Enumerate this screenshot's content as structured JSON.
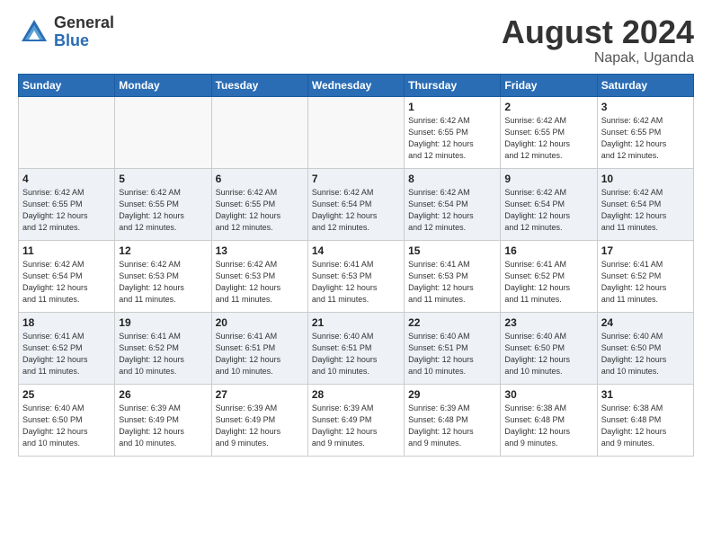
{
  "header": {
    "logo_general": "General",
    "logo_blue": "Blue",
    "month_year": "August 2024",
    "location": "Napak, Uganda"
  },
  "days_of_week": [
    "Sunday",
    "Monday",
    "Tuesday",
    "Wednesday",
    "Thursday",
    "Friday",
    "Saturday"
  ],
  "weeks": [
    [
      {
        "day": "",
        "info": ""
      },
      {
        "day": "",
        "info": ""
      },
      {
        "day": "",
        "info": ""
      },
      {
        "day": "",
        "info": ""
      },
      {
        "day": "1",
        "info": "Sunrise: 6:42 AM\nSunset: 6:55 PM\nDaylight: 12 hours\nand 12 minutes."
      },
      {
        "day": "2",
        "info": "Sunrise: 6:42 AM\nSunset: 6:55 PM\nDaylight: 12 hours\nand 12 minutes."
      },
      {
        "day": "3",
        "info": "Sunrise: 6:42 AM\nSunset: 6:55 PM\nDaylight: 12 hours\nand 12 minutes."
      }
    ],
    [
      {
        "day": "4",
        "info": "Sunrise: 6:42 AM\nSunset: 6:55 PM\nDaylight: 12 hours\nand 12 minutes."
      },
      {
        "day": "5",
        "info": "Sunrise: 6:42 AM\nSunset: 6:55 PM\nDaylight: 12 hours\nand 12 minutes."
      },
      {
        "day": "6",
        "info": "Sunrise: 6:42 AM\nSunset: 6:55 PM\nDaylight: 12 hours\nand 12 minutes."
      },
      {
        "day": "7",
        "info": "Sunrise: 6:42 AM\nSunset: 6:54 PM\nDaylight: 12 hours\nand 12 minutes."
      },
      {
        "day": "8",
        "info": "Sunrise: 6:42 AM\nSunset: 6:54 PM\nDaylight: 12 hours\nand 12 minutes."
      },
      {
        "day": "9",
        "info": "Sunrise: 6:42 AM\nSunset: 6:54 PM\nDaylight: 12 hours\nand 12 minutes."
      },
      {
        "day": "10",
        "info": "Sunrise: 6:42 AM\nSunset: 6:54 PM\nDaylight: 12 hours\nand 11 minutes."
      }
    ],
    [
      {
        "day": "11",
        "info": "Sunrise: 6:42 AM\nSunset: 6:54 PM\nDaylight: 12 hours\nand 11 minutes."
      },
      {
        "day": "12",
        "info": "Sunrise: 6:42 AM\nSunset: 6:53 PM\nDaylight: 12 hours\nand 11 minutes."
      },
      {
        "day": "13",
        "info": "Sunrise: 6:42 AM\nSunset: 6:53 PM\nDaylight: 12 hours\nand 11 minutes."
      },
      {
        "day": "14",
        "info": "Sunrise: 6:41 AM\nSunset: 6:53 PM\nDaylight: 12 hours\nand 11 minutes."
      },
      {
        "day": "15",
        "info": "Sunrise: 6:41 AM\nSunset: 6:53 PM\nDaylight: 12 hours\nand 11 minutes."
      },
      {
        "day": "16",
        "info": "Sunrise: 6:41 AM\nSunset: 6:52 PM\nDaylight: 12 hours\nand 11 minutes."
      },
      {
        "day": "17",
        "info": "Sunrise: 6:41 AM\nSunset: 6:52 PM\nDaylight: 12 hours\nand 11 minutes."
      }
    ],
    [
      {
        "day": "18",
        "info": "Sunrise: 6:41 AM\nSunset: 6:52 PM\nDaylight: 12 hours\nand 11 minutes."
      },
      {
        "day": "19",
        "info": "Sunrise: 6:41 AM\nSunset: 6:52 PM\nDaylight: 12 hours\nand 10 minutes."
      },
      {
        "day": "20",
        "info": "Sunrise: 6:41 AM\nSunset: 6:51 PM\nDaylight: 12 hours\nand 10 minutes."
      },
      {
        "day": "21",
        "info": "Sunrise: 6:40 AM\nSunset: 6:51 PM\nDaylight: 12 hours\nand 10 minutes."
      },
      {
        "day": "22",
        "info": "Sunrise: 6:40 AM\nSunset: 6:51 PM\nDaylight: 12 hours\nand 10 minutes."
      },
      {
        "day": "23",
        "info": "Sunrise: 6:40 AM\nSunset: 6:50 PM\nDaylight: 12 hours\nand 10 minutes."
      },
      {
        "day": "24",
        "info": "Sunrise: 6:40 AM\nSunset: 6:50 PM\nDaylight: 12 hours\nand 10 minutes."
      }
    ],
    [
      {
        "day": "25",
        "info": "Sunrise: 6:40 AM\nSunset: 6:50 PM\nDaylight: 12 hours\nand 10 minutes."
      },
      {
        "day": "26",
        "info": "Sunrise: 6:39 AM\nSunset: 6:49 PM\nDaylight: 12 hours\nand 10 minutes."
      },
      {
        "day": "27",
        "info": "Sunrise: 6:39 AM\nSunset: 6:49 PM\nDaylight: 12 hours\nand 9 minutes."
      },
      {
        "day": "28",
        "info": "Sunrise: 6:39 AM\nSunset: 6:49 PM\nDaylight: 12 hours\nand 9 minutes."
      },
      {
        "day": "29",
        "info": "Sunrise: 6:39 AM\nSunset: 6:48 PM\nDaylight: 12 hours\nand 9 minutes."
      },
      {
        "day": "30",
        "info": "Sunrise: 6:38 AM\nSunset: 6:48 PM\nDaylight: 12 hours\nand 9 minutes."
      },
      {
        "day": "31",
        "info": "Sunrise: 6:38 AM\nSunset: 6:48 PM\nDaylight: 12 hours\nand 9 minutes."
      }
    ]
  ]
}
